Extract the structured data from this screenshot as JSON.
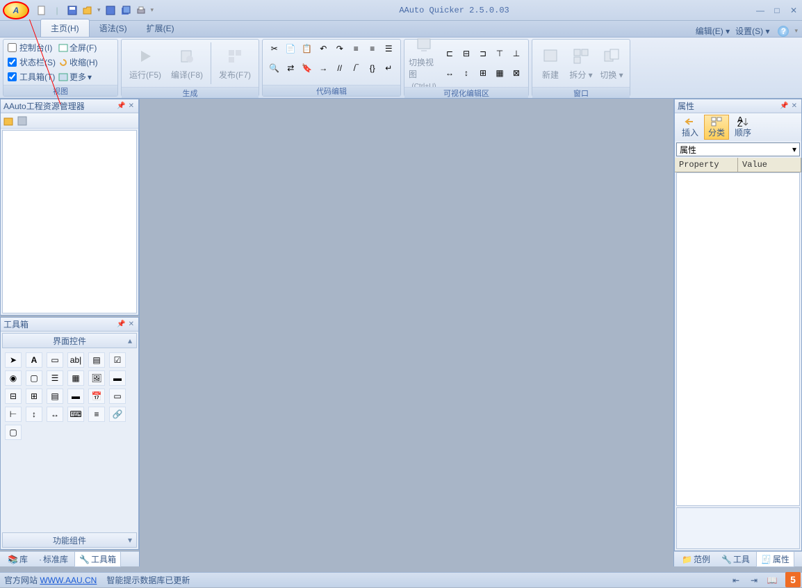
{
  "app": {
    "title": "AAuto Quicker 2.5.0.03"
  },
  "qat": {
    "icons": [
      "new-file",
      "save-disk",
      "folder-open",
      "save",
      "floppy",
      "export",
      "print"
    ]
  },
  "tabs": {
    "items": [
      {
        "label": "主页(H)",
        "active": true
      },
      {
        "label": "语法(S)",
        "active": false
      },
      {
        "label": "扩展(E)",
        "active": false
      }
    ],
    "right": {
      "edit": "编辑(E)",
      "settings": "设置(S)"
    }
  },
  "ribbon": {
    "view": {
      "label": "视图",
      "console": "控制台(I)",
      "fullscreen": "全屏(F)",
      "statusbar": "状态栏(S)",
      "collapse": "收缩(H)",
      "toolbox": "工具箱(T)",
      "more": "更多"
    },
    "build": {
      "label": "生成",
      "run": "运行(F5)",
      "compile": "编译(F8)",
      "publish": "发布(F7)"
    },
    "codeedit": {
      "label": "代码编辑"
    },
    "visual": {
      "label": "可视化编辑区",
      "switchview": "切换视图",
      "shortcut": "(Ctrl+U)"
    },
    "window": {
      "label": "窗口",
      "new": "新建",
      "split": "拆分",
      "switch": "切换"
    }
  },
  "explorer": {
    "title": "AAuto工程资源管理器"
  },
  "toolbox": {
    "title": "工具箱",
    "cat_ui": "界面控件",
    "cat_func": "功能组件"
  },
  "sidetabs_left": {
    "lib": "库",
    "stdlib": "标准库",
    "toolbox": "工具箱"
  },
  "props": {
    "title": "属性",
    "insert": "插入",
    "category": "分类",
    "sort": "顺序",
    "dropdown": "属性",
    "col_prop": "Property",
    "col_val": "Value"
  },
  "sidetabs_right": {
    "example": "范例",
    "tools": "工具",
    "props": "属性"
  },
  "status": {
    "link_label": "官方网站",
    "link_url": "WWW.AAU.CN",
    "msg": "智能提示数据库已更新"
  },
  "watermark": "5"
}
